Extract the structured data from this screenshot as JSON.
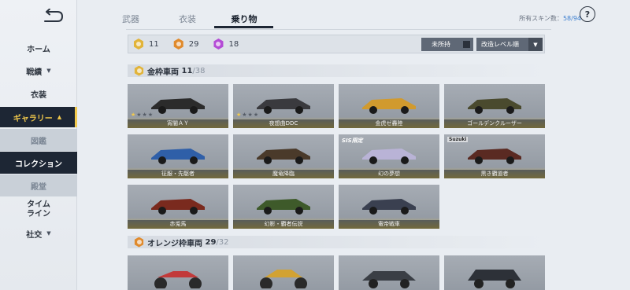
{
  "sidebar": {
    "back_icon": "back-arrow-icon",
    "items": [
      {
        "label": "ホーム",
        "arrow": ""
      },
      {
        "label": "戦績",
        "arrow": "▼"
      },
      {
        "label": "衣装",
        "arrow": ""
      },
      {
        "label": "ギャラリー",
        "arrow": "▲"
      },
      {
        "label": "図鑑",
        "arrow": ""
      },
      {
        "label": "コレクション",
        "arrow": ""
      },
      {
        "label": "殿堂",
        "arrow": ""
      },
      {
        "label": "タイム",
        "label2": "ライン",
        "arrow": ""
      },
      {
        "label": "社交",
        "arrow": "▼"
      }
    ]
  },
  "tabs": [
    {
      "label": "武器"
    },
    {
      "label": "衣装"
    },
    {
      "label": "乗り物"
    }
  ],
  "header": {
    "skin_count_label": "所有スキン数：",
    "skin_count_value": "58/94",
    "help_label": "?"
  },
  "filter": {
    "gold_count": "11",
    "orange_count": "29",
    "purple_count": "18",
    "owned_label": "未所持",
    "sort_label": "改造レベル順",
    "sort_arrow": "▼"
  },
  "sections": [
    {
      "title": "金枠車両",
      "owned": "11",
      "sep": "/",
      "total": "38"
    },
    {
      "title": "オレンジ枠車両",
      "owned": "29",
      "sep": "/",
      "total": "32"
    }
  ],
  "gold_cards": [
    {
      "name": "宵闇ＡＹ",
      "stars": "★",
      "stars_off": "★★★",
      "tag": ""
    },
    {
      "name": "夜想曲DDC",
      "stars": "★",
      "stars_off": "★★★",
      "tag": ""
    },
    {
      "name": "金虎ゼ轟陸",
      "stars": "",
      "stars_off": "",
      "tag": ""
    },
    {
      "name": "ゴールデンクルーザー",
      "stars": "",
      "stars_off": "",
      "tag": ""
    },
    {
      "name": "征服・先駆者",
      "stars": "",
      "stars_off": "",
      "tag": ""
    },
    {
      "name": "魔竜降臨",
      "stars": "",
      "stars_off": "",
      "tag": ""
    },
    {
      "name": "幻の夢想",
      "stars": "",
      "stars_off": "",
      "tag": "SIS限定"
    },
    {
      "name": "黒き覇道者",
      "stars": "",
      "stars_off": "",
      "tag": "Suzuki"
    },
    {
      "name": "赤兎馬",
      "stars": "",
      "stars_off": "",
      "tag": ""
    },
    {
      "name": "幻影・覇者伝説",
      "stars": "",
      "stars_off": "",
      "tag": ""
    },
    {
      "name": "電帝戦車",
      "stars": "",
      "stars_off": "",
      "tag": ""
    }
  ],
  "colors": {
    "sidebar_active_bg": "#1d2634",
    "accent_yellow": "#f2c94c",
    "gold_badge": "#e2b43a",
    "orange_badge": "#e08a2c",
    "purple_badge": "#b44bd6",
    "skin_count_blue": "#3d7fd0"
  }
}
